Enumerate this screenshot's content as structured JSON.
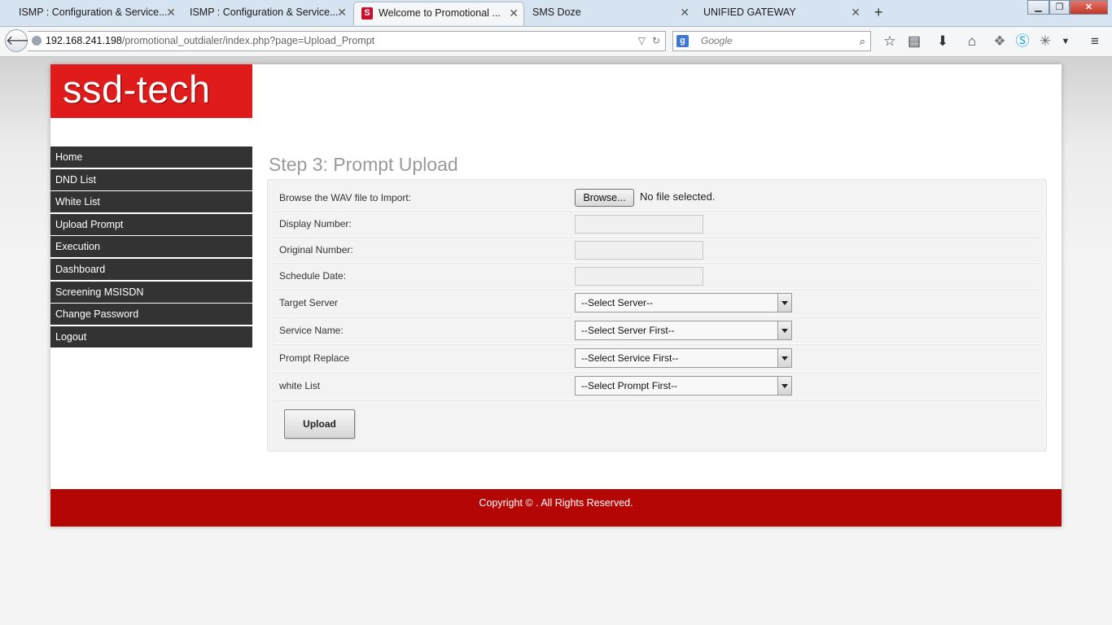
{
  "browser": {
    "tabs": [
      {
        "title": "ISMP : Configuration & Service...",
        "active": false
      },
      {
        "title": "ISMP : Configuration & Service...",
        "active": false
      },
      {
        "title": "Welcome to Promotional ...",
        "active": true,
        "favicon": "S"
      },
      {
        "title": "SMS Doze",
        "active": false
      },
      {
        "title": "UNIFIED GATEWAY",
        "active": false
      }
    ],
    "new_tab": "+",
    "url_host": "192.168.241.198",
    "url_path": "/promotional_outdialer/index.php?page=Upload_Prompt",
    "search_engine": "g",
    "search_placeholder": "Google",
    "toolbar_icons": [
      "bookmark-star-icon",
      "reading-list-icon",
      "download-icon",
      "home-icon",
      "extension-icon",
      "skype-icon",
      "bug-icon",
      "dropdown-icon",
      "menu-icon"
    ]
  },
  "brand": {
    "logo_text": "ssd-tech",
    "logo_color": "#e01b1b"
  },
  "sidebar": {
    "items": [
      {
        "label": "Home"
      },
      {
        "label": "DND List"
      },
      {
        "label": "White List"
      },
      {
        "label": "Upload Prompt"
      },
      {
        "label": "Execution"
      },
      {
        "label": "Dashboard"
      },
      {
        "label": "Screening MSISDN"
      },
      {
        "label": "Change Password"
      },
      {
        "label": "Logout"
      }
    ]
  },
  "main": {
    "title": "Step 3: Prompt Upload",
    "form": {
      "browse_label": "Browse the WAV file to Import:",
      "browse_button": "Browse...",
      "file_status": "No file selected.",
      "display_number_label": "Display Number:",
      "display_number_value": "",
      "original_number_label": "Original Number:",
      "original_number_value": "",
      "schedule_date_label": "Schedule Date:",
      "schedule_date_value": "",
      "target_server_label": "Target Server",
      "target_server_value": "--Select Server--",
      "service_name_label": "Service Name:",
      "service_name_value": "--Select Server First--",
      "prompt_replace_label": "Prompt Replace",
      "prompt_replace_value": "--Select Service First--",
      "white_list_label": "white List",
      "white_list_value": "--Select Prompt First--",
      "upload_button": "Upload"
    }
  },
  "footer": {
    "text": "Copyright © . All Rights Reserved.",
    "color": "#b50606"
  }
}
